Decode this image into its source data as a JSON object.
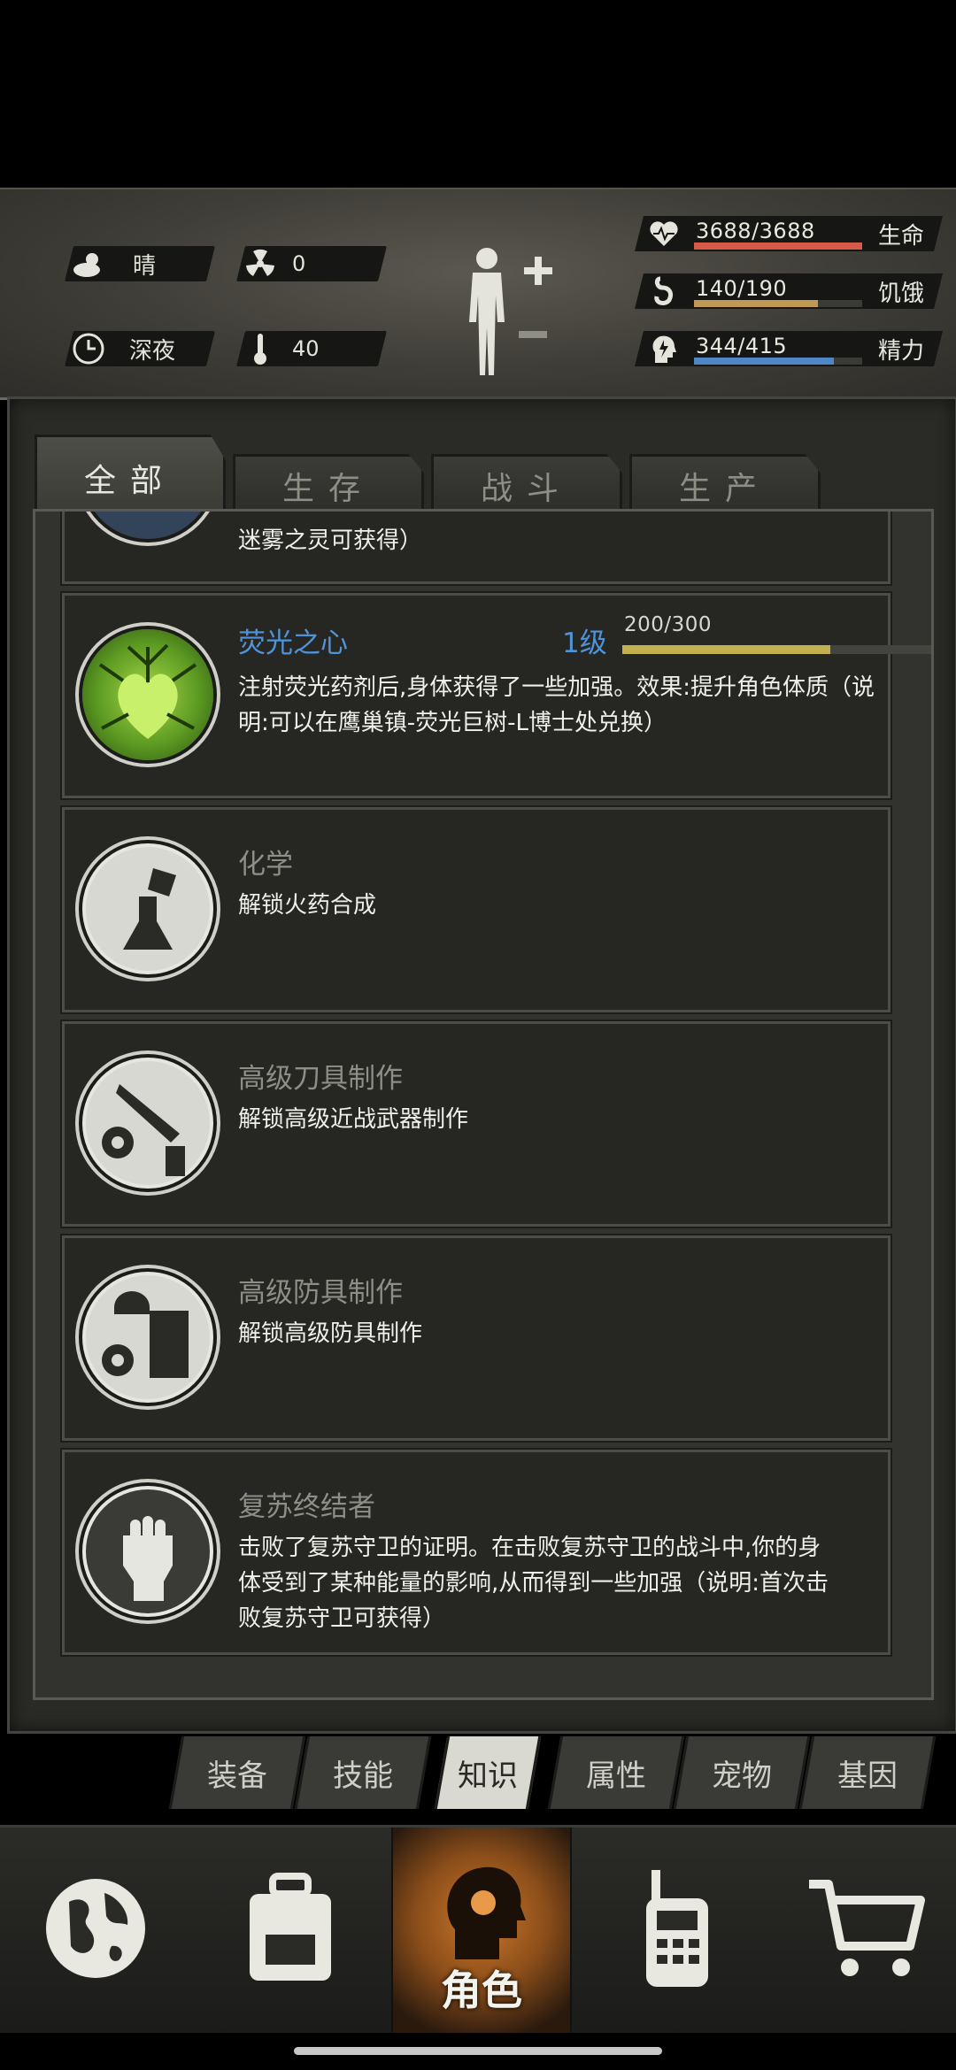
{
  "environment": {
    "weather": "晴",
    "radiation": "0",
    "time_of_day": "深夜",
    "temperature": "40"
  },
  "vitals": [
    {
      "label": "生命",
      "value": "3688/3688",
      "fraction": 1.0,
      "color": "#d65a4a",
      "icon": "heart-pulse-icon"
    },
    {
      "label": "饥饿",
      "value": "140/190",
      "fraction": 0.737,
      "color": "#c09a52",
      "icon": "stomach-icon"
    },
    {
      "label": "精力",
      "value": "344/415",
      "fraction": 0.829,
      "color": "#4f86c6",
      "icon": "head-energy-icon"
    }
  ],
  "tabs": [
    {
      "label": "全部",
      "active": true
    },
    {
      "label": "生存",
      "active": false
    },
    {
      "label": "战斗",
      "active": false
    },
    {
      "label": "生产",
      "active": false
    }
  ],
  "knowledge": [
    {
      "title": "",
      "desc": "迷雾之灵可获得）",
      "icon": "partial-icon"
    },
    {
      "title": "荧光之心",
      "level": "1级",
      "xp": "200/300",
      "xp_fraction": 0.667,
      "desc": "注射荧光药剂后,身体获得了一些加强。效果:提升角色体质（说明:可以在鹰巢镇-荧光巨树-L博士处兑换）",
      "icon": "glowing-heart-icon"
    },
    {
      "title": "化学",
      "desc": "解锁火药合成",
      "icon": "chemistry-flask-icon"
    },
    {
      "title": "高级刀具制作",
      "desc": "解锁高级近战武器制作",
      "icon": "knife-crafting-icon"
    },
    {
      "title": "高级防具制作",
      "desc": "解锁高级防具制作",
      "icon": "armor-crafting-icon"
    },
    {
      "title": "复苏终结者",
      "desc": "击败了复苏守卫的证明。在击败复苏守卫的战斗中,你的身体受到了某种能量的影响,从而得到一些加强（说明:首次击败复苏守卫可获得）",
      "icon": "fist-icon"
    }
  ],
  "subnav": [
    "装备",
    "技能",
    "知识",
    "属性",
    "宠物",
    "基因"
  ],
  "subnav_active": "知识",
  "bottomnav": {
    "active_label": "角色"
  }
}
